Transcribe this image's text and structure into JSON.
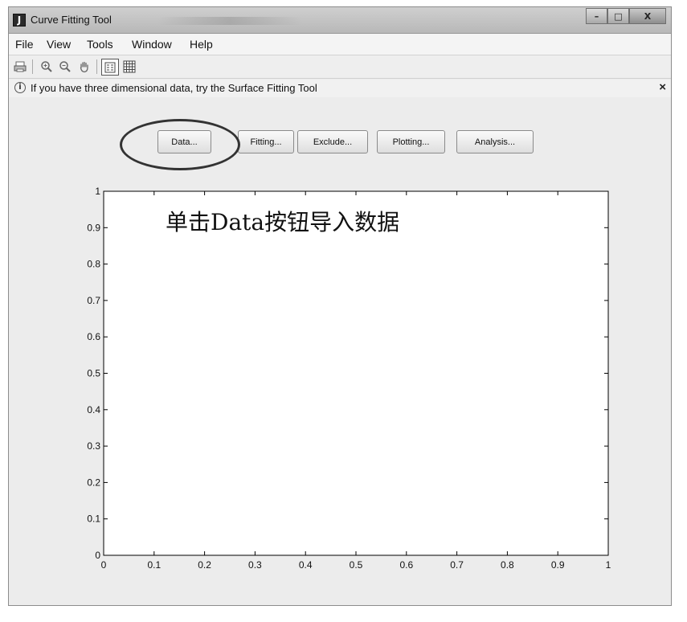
{
  "window": {
    "title": "Curve Fitting Tool",
    "app_icon_glyph": "J",
    "buttons": {
      "minimize": "–",
      "maximize": "□",
      "close": "X"
    }
  },
  "menubar": {
    "items": [
      "File",
      "View",
      "Tools",
      "Window",
      "Help"
    ]
  },
  "toolbar": {
    "icons": [
      "print-icon",
      "zoom-in-icon",
      "zoom-out-icon",
      "pan-hand-icon",
      "legend-toggle-icon",
      "grid-toggle-icon"
    ]
  },
  "infobar": {
    "icon": "info-icon",
    "text": "If you have three dimensional data, try the Surface Fitting Tool",
    "close": "×"
  },
  "actions": {
    "data": "Data...",
    "fitting": "Fitting...",
    "exclude": "Exclude...",
    "plotting": "Plotting...",
    "analysis": "Analysis..."
  },
  "annotation": {
    "text": "单击Data按钮导入数据"
  },
  "chart_data": {
    "type": "scatter",
    "x": [],
    "y": [],
    "xlim": [
      0,
      1
    ],
    "ylim": [
      0,
      1
    ],
    "xticks": [
      "0",
      "0.1",
      "0.2",
      "0.3",
      "0.4",
      "0.5",
      "0.6",
      "0.7",
      "0.8",
      "0.9",
      "1"
    ],
    "yticks": [
      "0",
      "0.1",
      "0.2",
      "0.3",
      "0.4",
      "0.5",
      "0.6",
      "0.7",
      "0.8",
      "0.9",
      "1"
    ],
    "grid": false,
    "title": "",
    "xlabel": "",
    "ylabel": ""
  }
}
